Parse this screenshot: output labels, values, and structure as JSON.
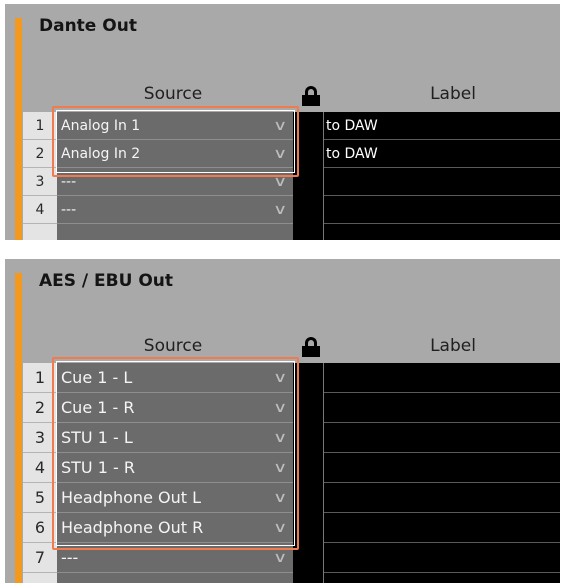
{
  "dante_panel": {
    "title": "Dante Out",
    "source_header": "Source",
    "label_header": "Label",
    "lock_icon": "lock-icon",
    "rows": [
      {
        "num": "1",
        "source": "Analog In  1",
        "label": "to DAW"
      },
      {
        "num": "2",
        "source": "Analog In  2",
        "label": "to DAW"
      },
      {
        "num": "3",
        "source": "---",
        "label": ""
      },
      {
        "num": "4",
        "source": "---",
        "label": ""
      }
    ]
  },
  "aes_panel": {
    "title": "AES / EBU Out",
    "source_header": "Source",
    "label_header": "Label",
    "lock_icon": "lock-icon",
    "rows": [
      {
        "num": "1",
        "source": "Cue 1 - L",
        "label": ""
      },
      {
        "num": "2",
        "source": "Cue 1 - R",
        "label": ""
      },
      {
        "num": "3",
        "source": "STU 1 - L",
        "label": ""
      },
      {
        "num": "4",
        "source": "STU 1 - R",
        "label": ""
      },
      {
        "num": "5",
        "source": "Headphone Out L",
        "label": ""
      },
      {
        "num": "6",
        "source": "Headphone Out R",
        "label": ""
      },
      {
        "num": "7",
        "source": "---",
        "label": ""
      }
    ]
  },
  "colors": {
    "accent": "#f39a1e",
    "highlight": "#ef7b4e",
    "panel_bg": "#a9a9a9",
    "source_bg": "#6b6b6b",
    "label_bg": "#000000"
  }
}
